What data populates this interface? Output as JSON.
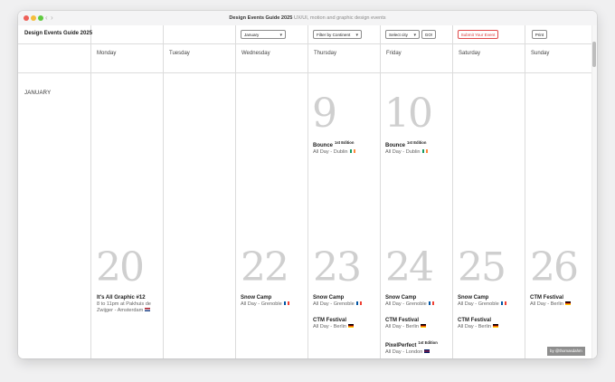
{
  "window": {
    "title_main": "Design Events Guide 2025",
    "title_sub": "UX/UI, motion and graphic design events"
  },
  "header": {
    "guide_title": "Design Events Guide 2025",
    "month_select": "January",
    "continent_filter": "Filter by Continent",
    "city_select": "Select city",
    "go_label": "GO!",
    "submit_label": "Submit Your Event",
    "print_label": "Print"
  },
  "days": [
    "Monday",
    "Tuesday",
    "Wednesday",
    "Thursday",
    "Friday",
    "Saturday",
    "Sunday"
  ],
  "month_label": "JANUARY",
  "week1": {
    "thursday": {
      "number": "9",
      "events": [
        {
          "name": "Bounce",
          "tag": "1st Edition",
          "meta": "All Day - Dublin",
          "flag": "ireland-flag-icon"
        }
      ]
    },
    "friday": {
      "number": "10",
      "events": [
        {
          "name": "Bounce",
          "tag": "1st Edition",
          "meta": "All Day - Dublin",
          "flag": "ireland-flag-icon"
        }
      ]
    }
  },
  "week2": {
    "monday": {
      "number": "20",
      "events": [
        {
          "name": "It's All Graphic #12",
          "meta": "8 to 11pm at Pakhuis de Zwijger - Amsterdam",
          "flag": "netherlands-flag-icon"
        }
      ]
    },
    "wednesday": {
      "number": "22",
      "events": [
        {
          "name": "Snow Camp",
          "meta": "All Day - Grenoble",
          "flag": "france-flag-icon"
        }
      ]
    },
    "thursday": {
      "number": "23",
      "events": [
        {
          "name": "Snow Camp",
          "meta": "All Day - Grenoble",
          "flag": "france-flag-icon"
        },
        {
          "name": "CTM Festival",
          "meta": "All Day - Berlin",
          "flag": "germany-flag-icon"
        }
      ]
    },
    "friday": {
      "number": "24",
      "events": [
        {
          "name": "Snow Camp",
          "meta": "All Day - Grenoble",
          "flag": "france-flag-icon"
        },
        {
          "name": "CTM Festival",
          "meta": "All Day - Berlin",
          "flag": "germany-flag-icon"
        },
        {
          "name": "PixelPerfect",
          "tag": "1st Edition",
          "meta": "All Day - London",
          "flag": "uk-flag-icon"
        }
      ]
    },
    "saturday": {
      "number": "25",
      "events": [
        {
          "name": "Snow Camp",
          "meta": "All Day - Grenoble",
          "flag": "france-flag-icon"
        },
        {
          "name": "CTM Festival",
          "meta": "All Day - Berlin",
          "flag": "germany-flag-icon"
        }
      ]
    },
    "sunday": {
      "number": "26",
      "events": [
        {
          "name": "CTM Festival",
          "meta": "All Day - Berlin",
          "flag": "germany-flag-icon"
        }
      ]
    }
  },
  "credit": "by @thomasdahm",
  "colors": {
    "date_number": "#cfcfcf",
    "grid_line": "#dcdcdc",
    "submit_accent": "#d93a3a"
  }
}
